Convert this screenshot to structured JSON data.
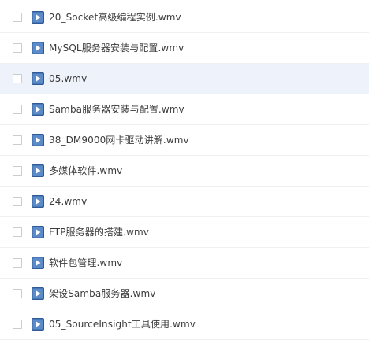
{
  "files": [
    {
      "name": "20_Socket高级编程实例.wmv",
      "icon": "video-file-icon",
      "selected": false
    },
    {
      "name": "MySQL服务器安装与配置.wmv",
      "icon": "video-file-icon",
      "selected": false
    },
    {
      "name": "05.wmv",
      "icon": "video-file-icon",
      "selected": true
    },
    {
      "name": "Samba服务器安装与配置.wmv",
      "icon": "video-file-icon",
      "selected": false
    },
    {
      "name": "38_DM9000网卡驱动讲解.wmv",
      "icon": "video-file-icon",
      "selected": false
    },
    {
      "name": "多媒体软件.wmv",
      "icon": "video-file-icon",
      "selected": false
    },
    {
      "name": "24.wmv",
      "icon": "video-file-icon",
      "selected": false
    },
    {
      "name": "FTP服务器的搭建.wmv",
      "icon": "video-file-icon",
      "selected": false
    },
    {
      "name": "软件包管理.wmv",
      "icon": "video-file-icon",
      "selected": false
    },
    {
      "name": "架设Samba服务器.wmv",
      "icon": "video-file-icon",
      "selected": false
    },
    {
      "name": "05_SourceInsight工具使用.wmv",
      "icon": "video-file-icon",
      "selected": false
    }
  ],
  "colors": {
    "row_selected_bg": "#eef3fb",
    "icon_blue": "#4a78b5",
    "icon_blue_dark": "#2f5a96"
  }
}
